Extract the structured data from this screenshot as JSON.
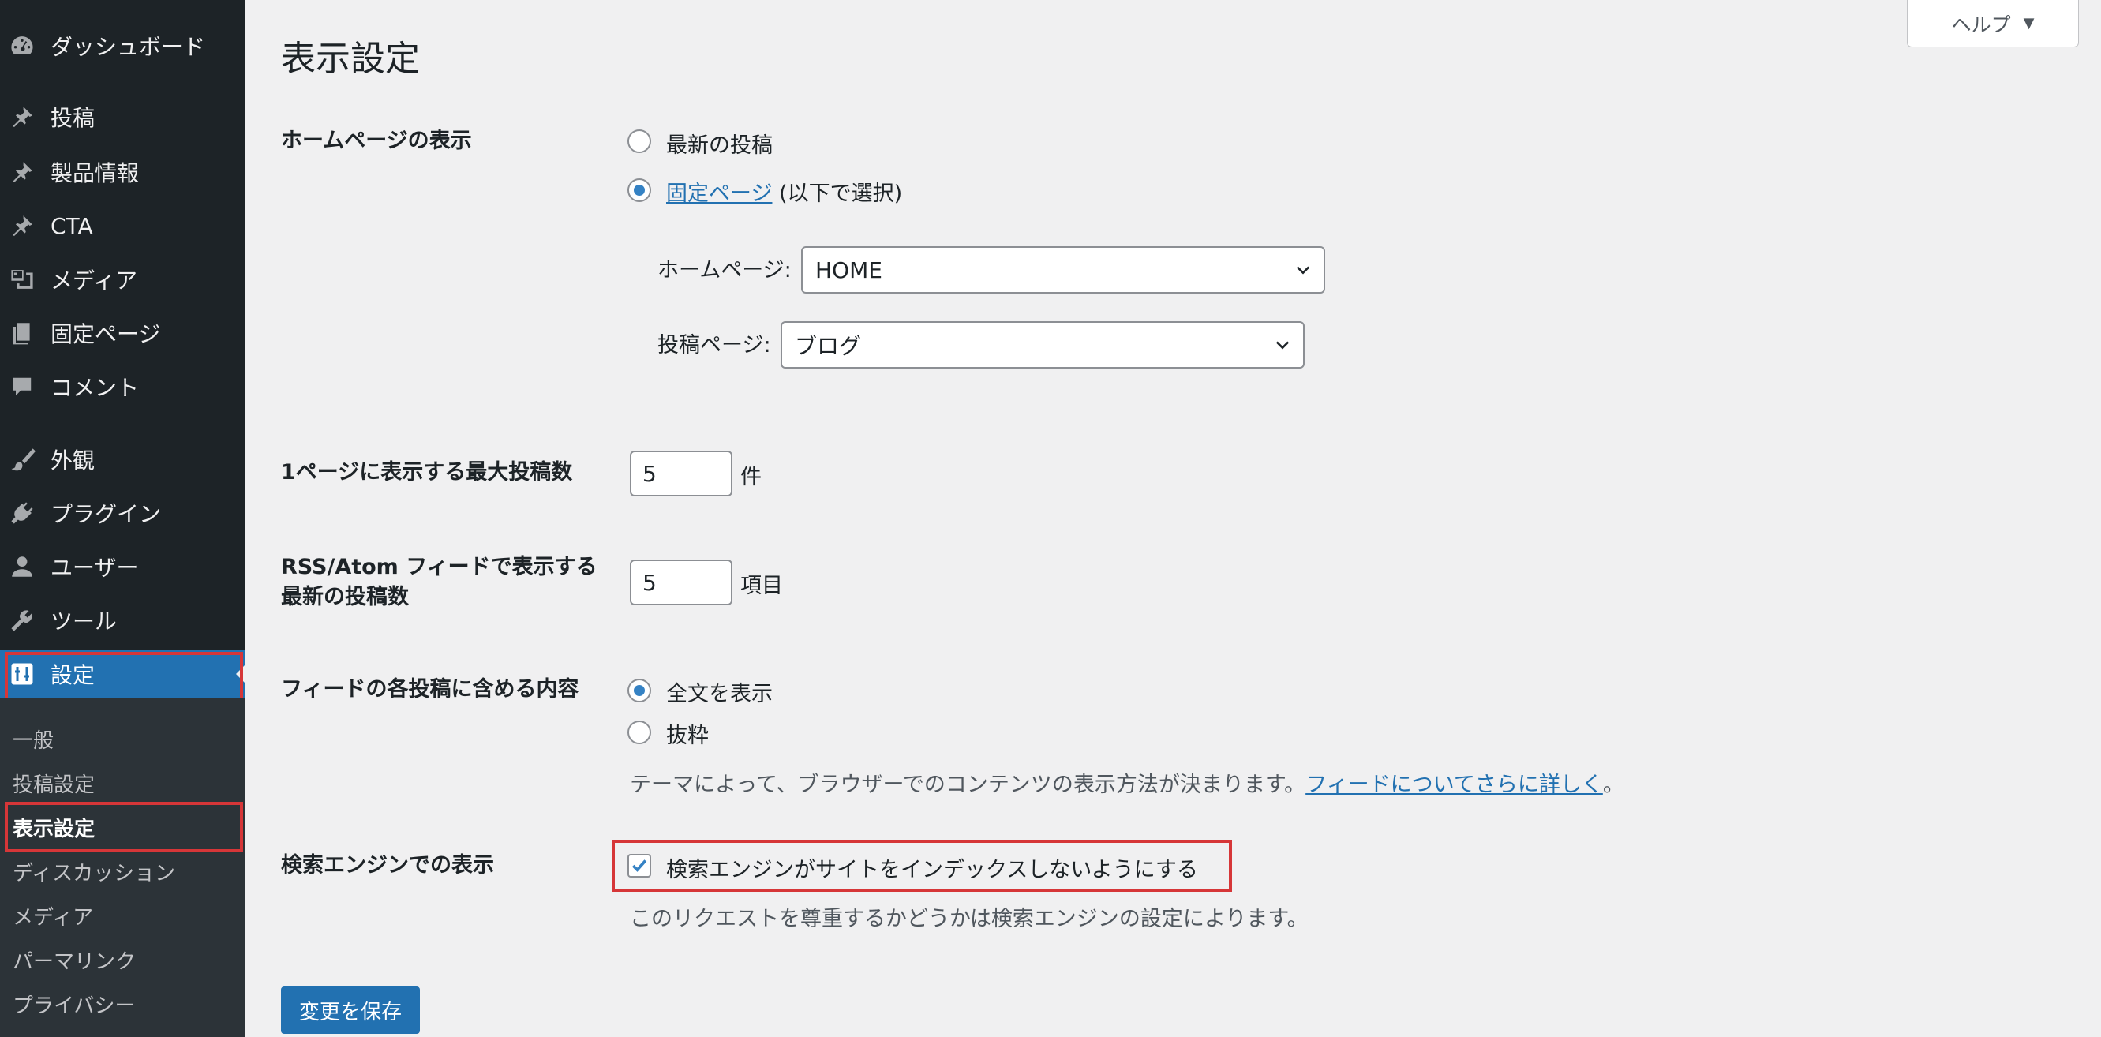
{
  "sidebar": {
    "menu": [
      {
        "label": "ダッシュボード",
        "icon": "dashboard-icon"
      },
      {
        "label": "投稿",
        "icon": "pin-icon"
      },
      {
        "label": "製品情報",
        "icon": "pin-icon"
      },
      {
        "label": "CTA",
        "icon": "pin-icon"
      },
      {
        "label": "メディア",
        "icon": "media-icon"
      },
      {
        "label": "固定ページ",
        "icon": "pages-icon"
      },
      {
        "label": "コメント",
        "icon": "comment-icon"
      },
      {
        "label": "外観",
        "icon": "brush-icon"
      },
      {
        "label": "プラグイン",
        "icon": "plugin-icon"
      },
      {
        "label": "ユーザー",
        "icon": "user-icon"
      },
      {
        "label": "ツール",
        "icon": "wrench-icon"
      },
      {
        "label": "設定",
        "icon": "settings-icon"
      }
    ],
    "submenu": [
      "一般",
      "投稿設定",
      "表示設定",
      "ディスカッション",
      "メディア",
      "パーマリンク",
      "プライバシー"
    ]
  },
  "header": {
    "title": "表示設定",
    "help_label": "ヘルプ",
    "help_arrow": "▼"
  },
  "settings": {
    "homepage_display": {
      "label": "ホームページの表示",
      "option_latest": "最新の投稿",
      "option_static_link": "固定ページ",
      "option_static_suffix": " (以下で選択)",
      "selected": "static",
      "homepage_label": "ホームページ:",
      "homepage_value": "HOME",
      "postspage_label": "投稿ページ:",
      "postspage_value": "ブログ"
    },
    "posts_per_page": {
      "label": "1ページに表示する最大投稿数",
      "value": "5",
      "unit": "件"
    },
    "rss_count": {
      "label_line1": "RSS/Atom フィードで表示する",
      "label_line2": "最新の投稿数",
      "value": "5",
      "unit": "項目"
    },
    "feed_content": {
      "label": "フィードの各投稿に含める内容",
      "option_full": "全文を表示",
      "option_excerpt": "抜粋",
      "selected": "full",
      "desc_text": "テーマによって、ブラウザーでのコンテンツの表示方法が決まります。",
      "desc_link": "フィードについてさらに詳しく",
      "desc_end": "。"
    },
    "search_visibility": {
      "label": "検索エンジンでの表示",
      "checkbox_label": "検索エンジンがサイトをインデックスしないようにする",
      "checked": true,
      "desc": "このリクエストを尊重するかどうかは検索エンジンの設定によります。"
    }
  },
  "save_button": "変更を保存",
  "colors": {
    "sidebar_bg": "#1d2327",
    "accent": "#2271b1",
    "highlight": "#d63638"
  }
}
